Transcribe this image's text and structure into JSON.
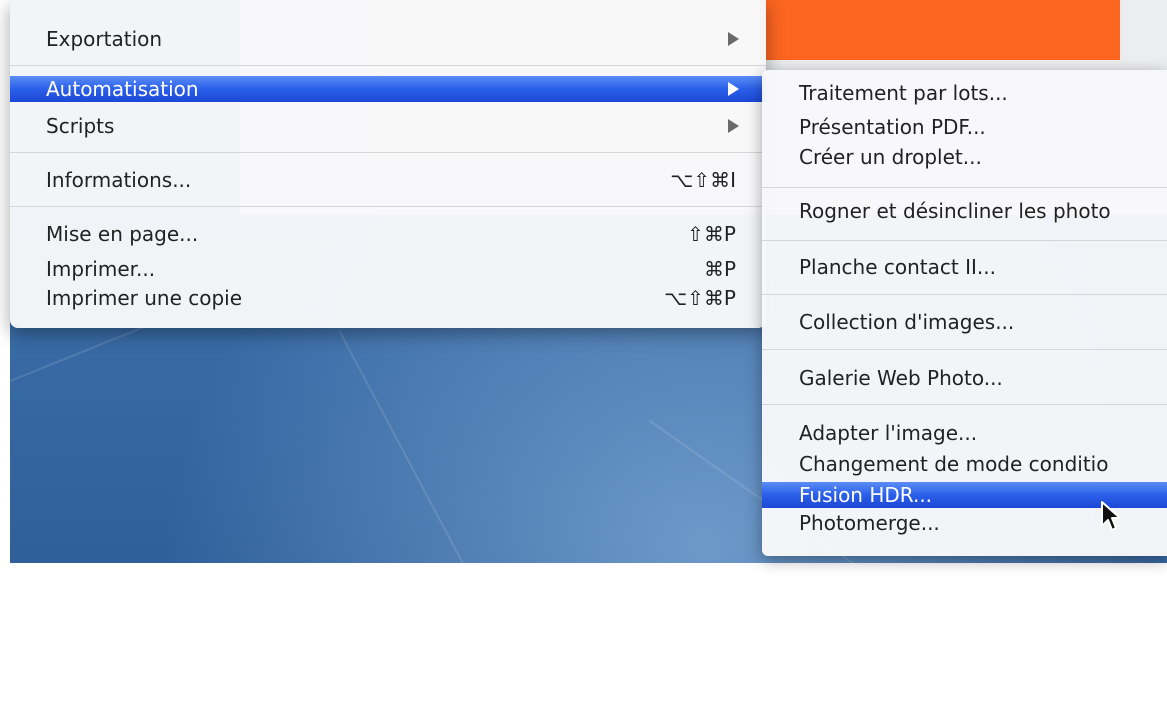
{
  "main_menu": {
    "items": [
      {
        "label": "Exportation",
        "submenu": true
      },
      {
        "label": "Automatisation",
        "submenu": true,
        "active": true
      },
      {
        "label": "Scripts",
        "submenu": true
      },
      {
        "label": "Informations...",
        "shortcut": "⌥⇧⌘I"
      },
      {
        "label": "Mise en page...",
        "shortcut": "⇧⌘P"
      },
      {
        "label": "Imprimer...",
        "shortcut": "⌘P"
      },
      {
        "label": "Imprimer une copie",
        "shortcut": "⌥⇧⌘P"
      }
    ]
  },
  "submenu": {
    "items": [
      {
        "label": "Traitement par lots..."
      },
      {
        "label": "Présentation PDF..."
      },
      {
        "label": "Créer un droplet..."
      },
      {
        "label": "Rogner et désincliner les photo"
      },
      {
        "label": "Planche contact II..."
      },
      {
        "label": "Collection d'images..."
      },
      {
        "label": "Galerie Web Photo..."
      },
      {
        "label": "Adapter l'image..."
      },
      {
        "label": "Changement de mode conditio"
      },
      {
        "label": "Fusion HDR...",
        "active": true
      },
      {
        "label": "Photomerge..."
      }
    ]
  },
  "colors": {
    "highlight": "#2a5fe9",
    "window_accent": "#fb6520"
  },
  "icons": {
    "submenu_arrow": "triangle-right-icon",
    "mouse_cursor": "pointer-arrow-icon"
  }
}
